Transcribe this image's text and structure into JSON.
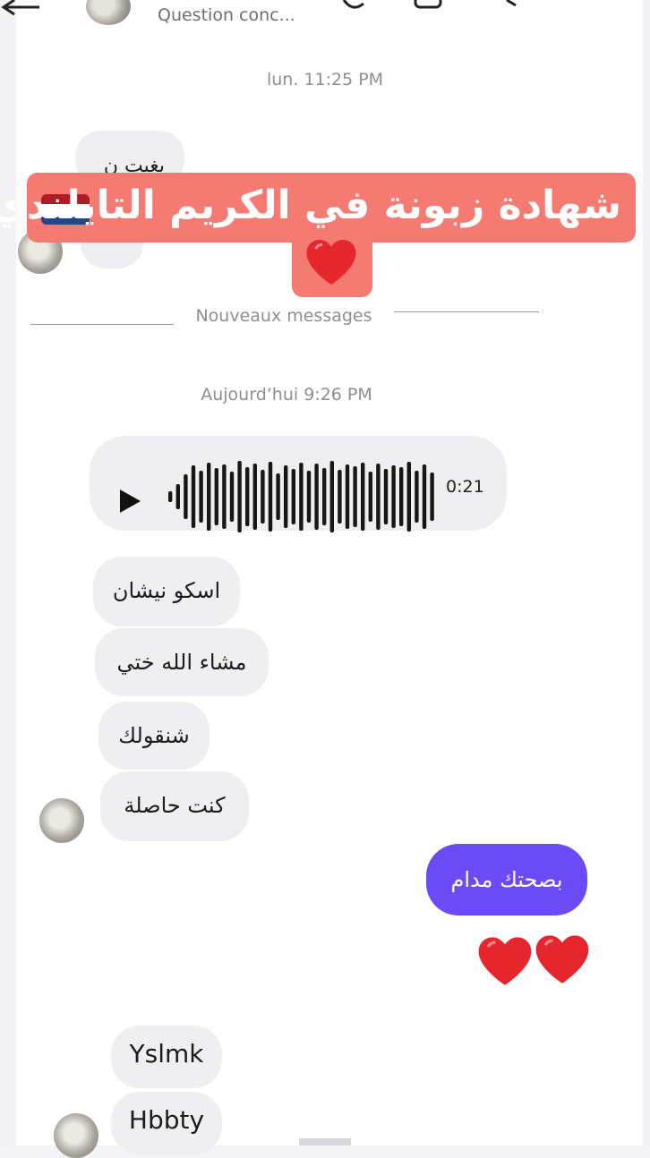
{
  "header": {
    "title": "Question conc..."
  },
  "timestamps": {
    "first": "lun. 11:25 PM",
    "second": "Aujourd’hui 9:26 PM"
  },
  "divider": {
    "label": "Nouveaux messages"
  },
  "overlay": {
    "banner_text": "شهادة زبونة في الكريم التايلندي",
    "flag_colors": [
      "#ae1c28",
      "#ffffff",
      "#21468b"
    ],
    "heart_icon": "red-heart"
  },
  "old_messages": [
    {
      "text": "بغيت ن"
    }
  ],
  "voice_message": {
    "duration": "0:21"
  },
  "received_messages": [
    {
      "text": "اسكو نيشان"
    },
    {
      "text": "مشاء الله ختي"
    },
    {
      "text": "شنقولك"
    },
    {
      "text": "كنت حاصلة"
    }
  ],
  "sent_messages": [
    {
      "text": "بصحتك مدام"
    }
  ],
  "reaction_hearts": [
    "red-heart",
    "red-heart"
  ],
  "later_messages": [
    {
      "text": "Yslmk"
    },
    {
      "text": "Hbbty"
    }
  ],
  "colors": {
    "sent_bubble": "#6a4bf6",
    "received_bubble": "#efeff1",
    "banner": "#f47a72",
    "heart": "#e5262d"
  }
}
